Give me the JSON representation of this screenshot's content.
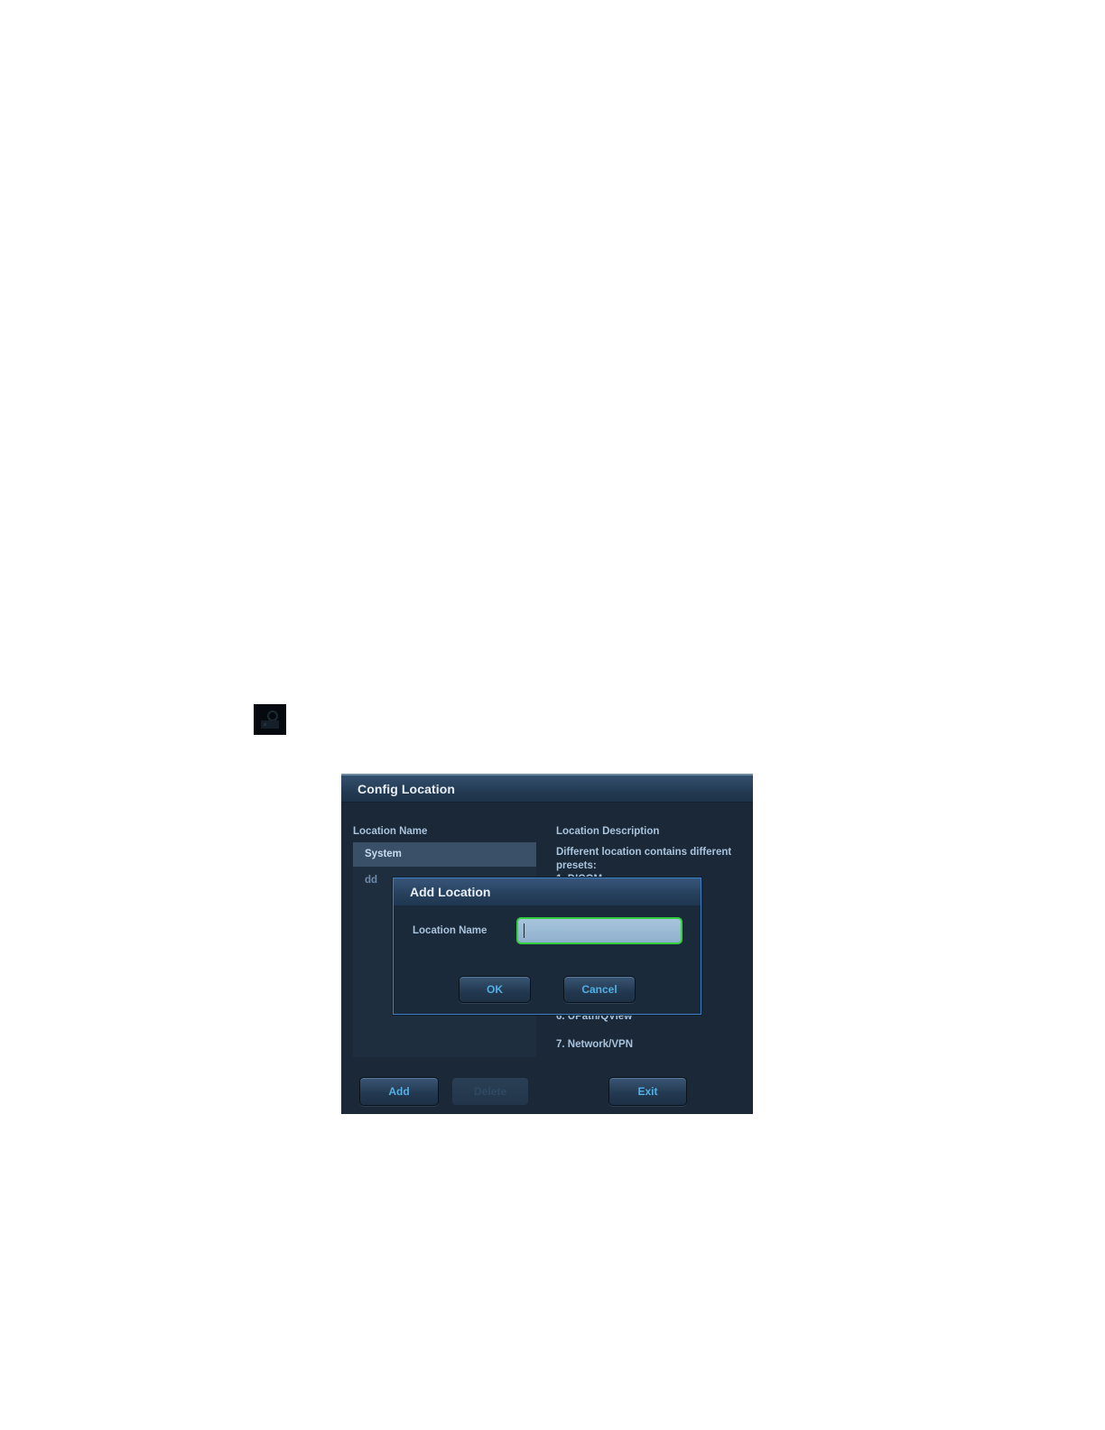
{
  "config_dialog": {
    "title": "Config Location",
    "location_name_label": "Location Name",
    "location_description_label": "Location Description",
    "locations": [
      "System",
      "dd"
    ],
    "description": {
      "intro": "Different location contains different presets:",
      "item_1": "1. DICOM",
      "item_6": "6. UPath/QView",
      "item_7": "7. Network/VPN"
    },
    "buttons": {
      "add": "Add",
      "delete": "Delete",
      "exit": "Exit"
    }
  },
  "add_location_dialog": {
    "title": "Add Location",
    "field_label": "Location Name",
    "field_value": "",
    "buttons": {
      "ok": "OK",
      "cancel": "Cancel"
    }
  },
  "colors": {
    "dialog_background": "#1a2838",
    "button_text": "#52b0e6",
    "focus_border": "#33d13f",
    "modal_border": "#3f7fc4"
  }
}
